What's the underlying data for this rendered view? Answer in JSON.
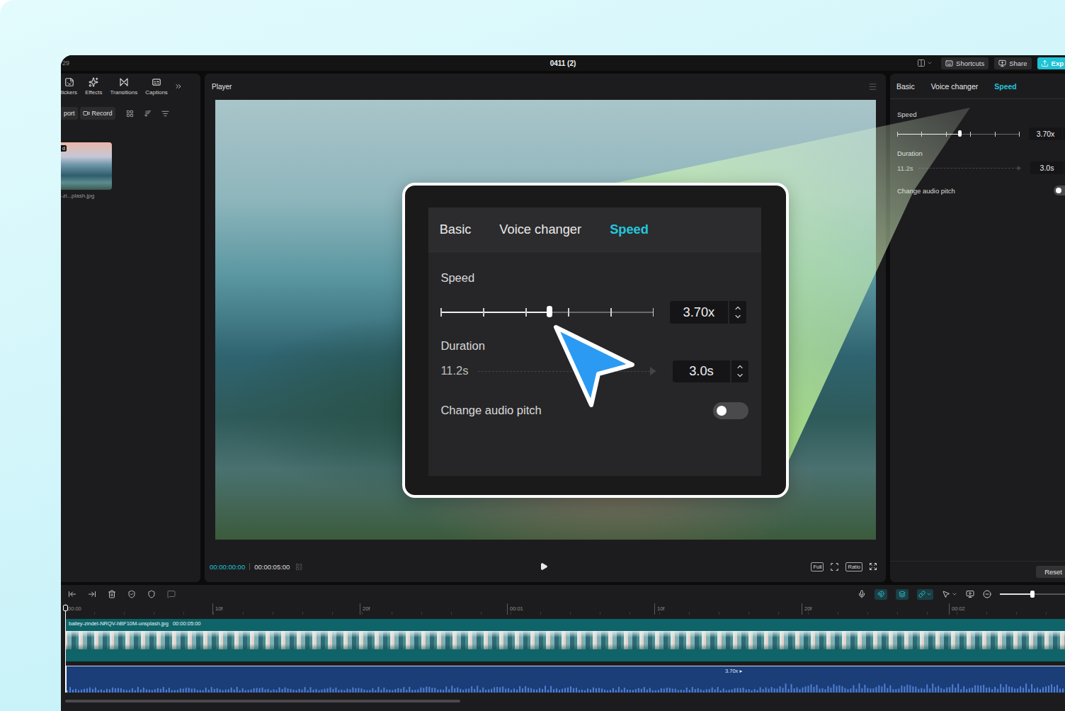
{
  "window": {
    "title": "0411 (2)",
    "project_tag": "29"
  },
  "title_buttons": [
    {
      "label": "Shortcuts",
      "kind": "plain"
    },
    {
      "label": "Share",
      "kind": "plain"
    },
    {
      "label": "Exp",
      "kind": "primary"
    }
  ],
  "media_tabs": [
    {
      "label": "tickers"
    },
    {
      "label": "Effects"
    },
    {
      "label": "Transitions"
    },
    {
      "label": "Captions"
    }
  ],
  "media_actions": [
    {
      "label": "port"
    },
    {
      "label": "Record"
    }
  ],
  "media_items": [
    {
      "badge": "d",
      "name": "-zi...plash.jpg"
    }
  ],
  "player": {
    "title": "Player",
    "current_time": "00:00:00:00",
    "total_time": "00:00:05:00",
    "view_buttons": [
      "Full",
      "Ratio"
    ]
  },
  "inspector": {
    "tabs": [
      {
        "label": "Basic",
        "selected": false
      },
      {
        "label": "Voice changer",
        "selected": false
      },
      {
        "label": "Speed",
        "selected": true
      }
    ],
    "speed": {
      "label": "Speed",
      "level": 0.51,
      "value": "3.70x"
    },
    "duration": {
      "label": "Duration",
      "original": "11.2s",
      "value": "3.0s"
    },
    "audio_pitch": {
      "label": "Change audio pitch",
      "on": false
    },
    "reset": "Reset"
  },
  "timeline": {
    "ruler": [
      "00:00",
      "10f",
      "20f",
      "00:01",
      "10f",
      "20f",
      "00:02"
    ],
    "video_clip": {
      "name": "bailey-zindel-NRQV-hBF10M-unsplash.jpg",
      "duration": "00:00:05:00"
    },
    "audio_clip": {
      "speed": "3.70x",
      "marker": "▸"
    },
    "zoom": {
      "level": 0.5
    }
  }
}
